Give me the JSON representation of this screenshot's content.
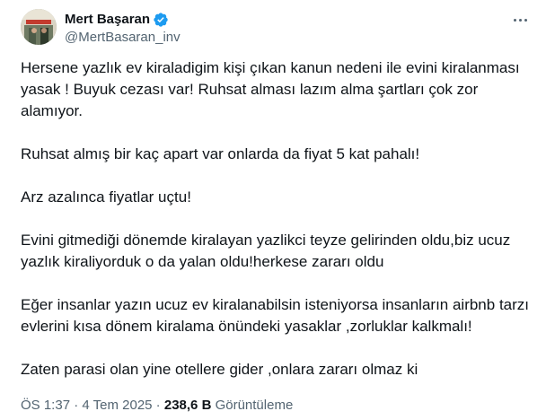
{
  "user": {
    "display_name": "Mert Başaran",
    "handle": "@MertBasaran_inv",
    "verified": true,
    "verified_color": "#1d9bf0"
  },
  "menu": {
    "icon": "more-horizontal-icon"
  },
  "tweet": {
    "paragraphs": [
      "Hersene yazlık ev kiraladigim kişi çıkan kanun nedeni ile evini kiralanması yasak ! Buyuk cezası var! Ruhsat alması lazım alma şartları çok zor alamıyor.",
      "Ruhsat almış bir kaç apart var onlarda da fiyat 5 kat pahalı!",
      "Arz azalınca fiyatlar uçtu!",
      "Evini gitmediği dönemde kiralayan yazlikci teyze gelirinden oldu,biz ucuz yazlık kiraliyorduk o da yalan oldu!herkese zararı oldu",
      "Eğer insanlar yazın ucuz ev kiralanabilsin isteniyorsa insanların airbnb tarzı evlerini kısa dönem kiralama önündeki yasaklar ,zorluklar kalkmalı!",
      "Zaten parasi olan yine otellere gider ,onlara zararı olmaz ki"
    ]
  },
  "meta": {
    "time": "ÖS 1:37",
    "separator": " · ",
    "date": "4 Tem 2025",
    "views_count": "238,6 B",
    "views_label": "Görüntüleme"
  }
}
